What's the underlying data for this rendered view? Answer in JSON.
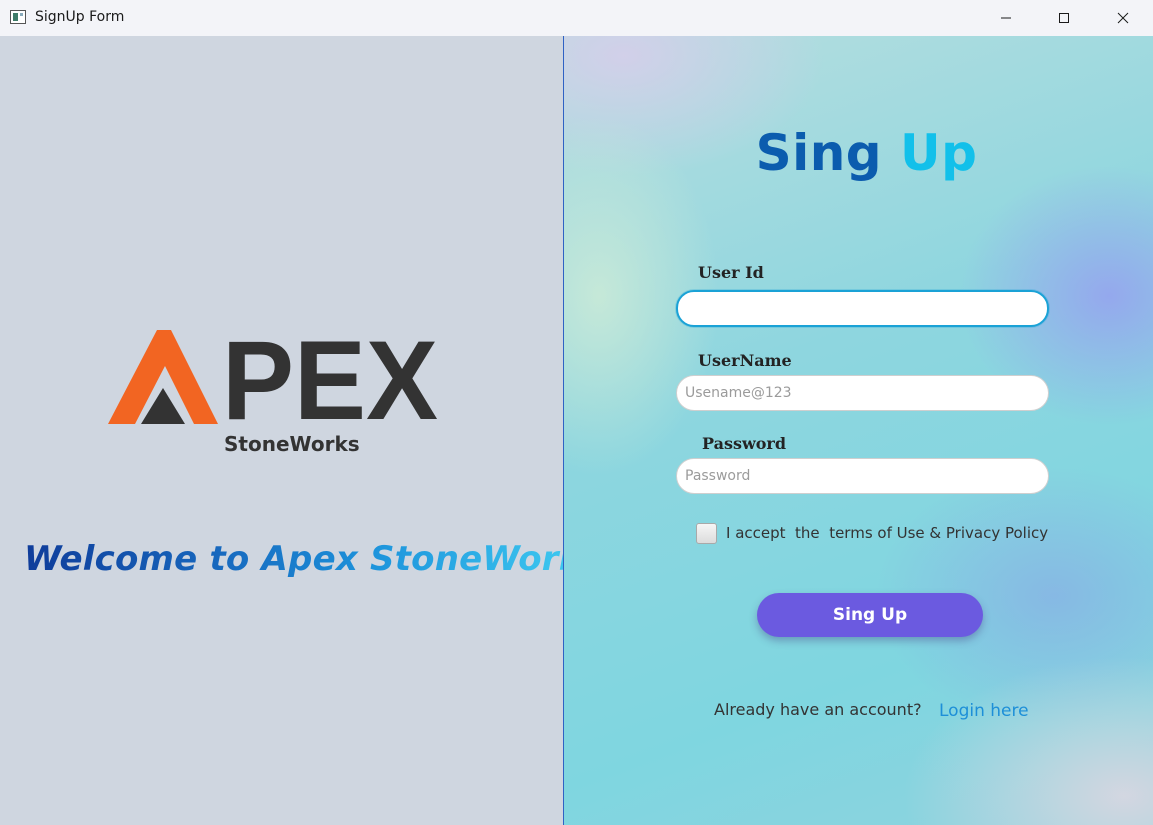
{
  "window": {
    "title": "SignUp Form",
    "controls": {
      "minimize": "minimize",
      "maximize": "maximize",
      "close": "close"
    }
  },
  "left": {
    "logo": {
      "text_main": "PEX",
      "text_sub": "StoneWorks",
      "accent_color": "#f26522",
      "dark_color": "#333333"
    },
    "welcome": "Welcome to Apex StoneWorks"
  },
  "form": {
    "title_part1": "Sing",
    "title_part2": "Up",
    "user_id": {
      "label": "User Id",
      "value": "",
      "placeholder": ""
    },
    "username": {
      "label": "UserName",
      "value": "",
      "placeholder": "Usename@123"
    },
    "password": {
      "label": "Password",
      "value": "",
      "placeholder": "Password"
    },
    "terms": {
      "text": "I accept  the  terms of Use & Privacy Policy",
      "checked": false
    },
    "submit_label": "Sing Up",
    "login_prompt": "Already have an account?",
    "login_link": "Login here"
  },
  "colors": {
    "left_bg": "#cfd6e0",
    "button": "#6b5ae0",
    "title_dark": "#0b5cae",
    "title_light": "#12c0ea",
    "link": "#1d8fd8",
    "focus_border": "#1aa2d6"
  }
}
